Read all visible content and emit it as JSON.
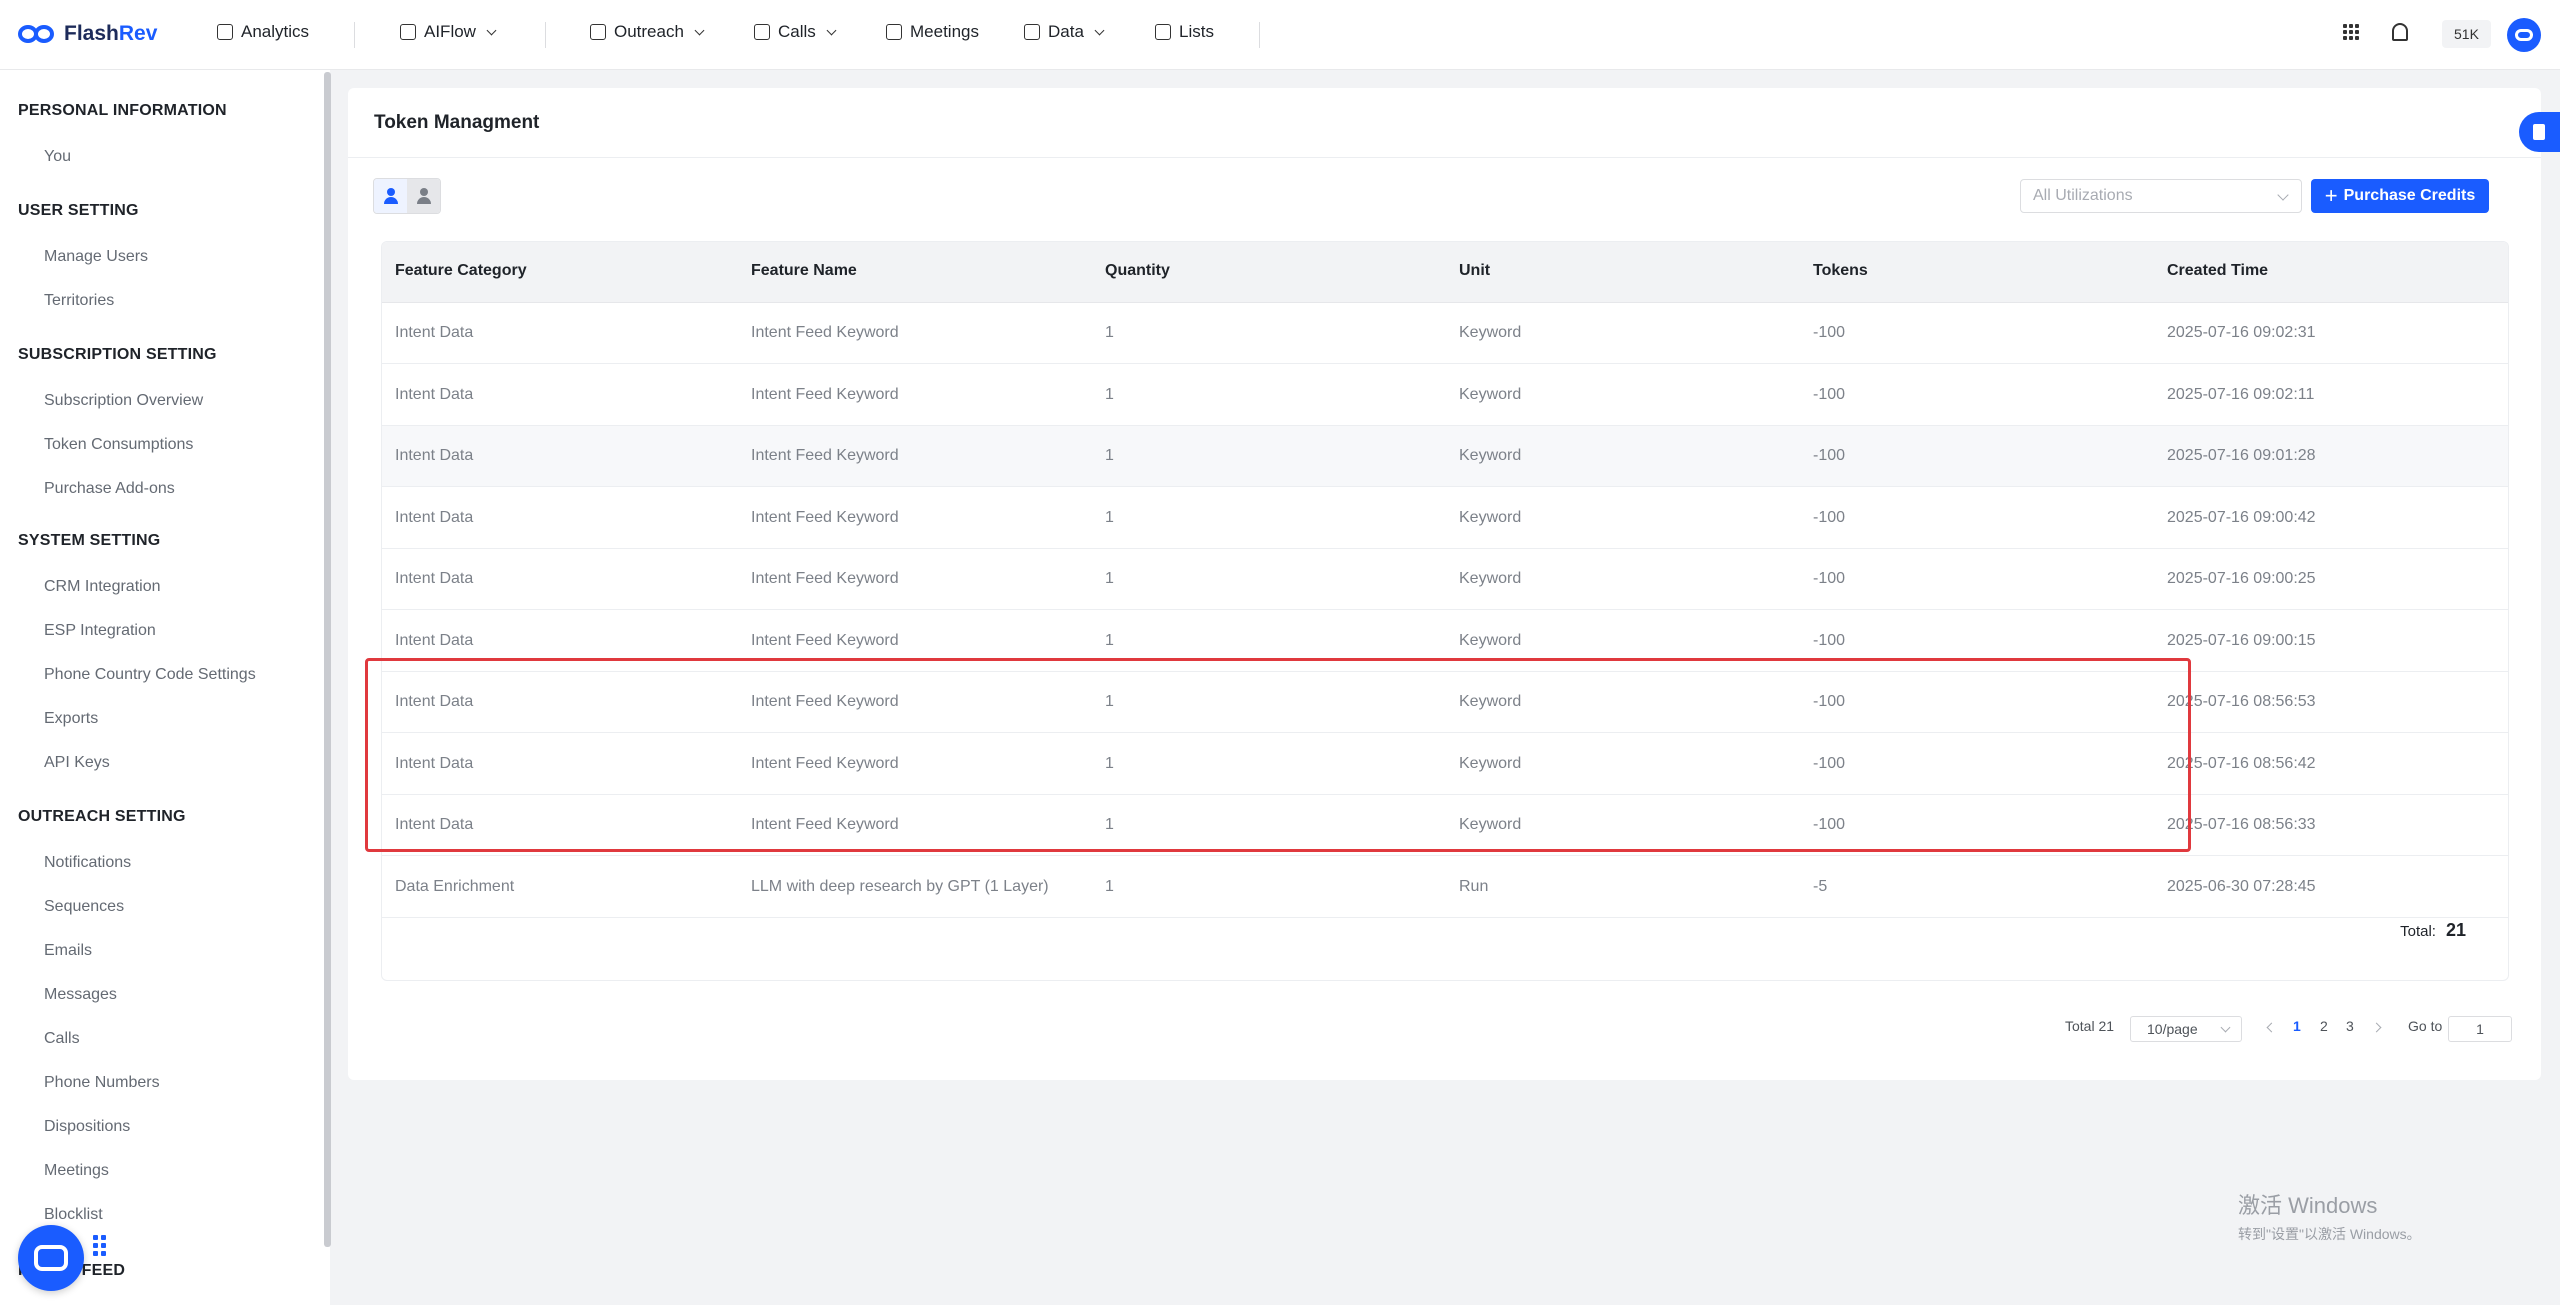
{
  "brand": {
    "name_part1": "Flash",
    "name_part2": "Rev",
    "accent": "#1a5cff"
  },
  "nav": {
    "analytics": "Analytics",
    "aiflow": "AIFlow",
    "outreach": "Outreach",
    "calls": "Calls",
    "meetings": "Meetings",
    "data": "Data",
    "lists": "Lists",
    "credits": "51K"
  },
  "sidebar": {
    "sections": [
      {
        "title": "PERSONAL INFORMATION",
        "items": [
          "You"
        ]
      },
      {
        "title": "USER SETTING",
        "items": [
          "Manage Users",
          "Territories"
        ]
      },
      {
        "title": "SUBSCRIPTION SETTING",
        "items": [
          "Subscription Overview",
          "Token Consumptions",
          "Purchase Add-ons"
        ]
      },
      {
        "title": "SYSTEM SETTING",
        "items": [
          "CRM Integration",
          "ESP Integration",
          "Phone Country Code Settings",
          "Exports",
          "API Keys"
        ]
      },
      {
        "title": "OUTREACH SETTING",
        "items": [
          "Notifications",
          "Sequences",
          "Emails",
          "Messages",
          "Calls",
          "Phone Numbers",
          "Dispositions",
          "Meetings",
          "Blocklist"
        ]
      },
      {
        "title": "INTENT FEED",
        "items": []
      }
    ]
  },
  "page": {
    "title": "Token Managment",
    "filter_placeholder": "All Utilizations",
    "purchase_label": "Purchase Credits"
  },
  "table": {
    "columns": [
      "Feature Category",
      "Feature Name",
      "Quantity",
      "Unit",
      "Tokens",
      "Created Time"
    ],
    "rows": [
      [
        "Intent Data",
        "Intent Feed Keyword",
        "1",
        "Keyword",
        "-100",
        "2025-07-16 09:02:31"
      ],
      [
        "Intent Data",
        "Intent Feed Keyword",
        "1",
        "Keyword",
        "-100",
        "2025-07-16 09:02:11"
      ],
      [
        "Intent Data",
        "Intent Feed Keyword",
        "1",
        "Keyword",
        "-100",
        "2025-07-16 09:01:28"
      ],
      [
        "Intent Data",
        "Intent Feed Keyword",
        "1",
        "Keyword",
        "-100",
        "2025-07-16 09:00:42"
      ],
      [
        "Intent Data",
        "Intent Feed Keyword",
        "1",
        "Keyword",
        "-100",
        "2025-07-16 09:00:25"
      ],
      [
        "Intent Data",
        "Intent Feed Keyword",
        "1",
        "Keyword",
        "-100",
        "2025-07-16 09:00:15"
      ],
      [
        "Intent Data",
        "Intent Feed Keyword",
        "1",
        "Keyword",
        "-100",
        "2025-07-16 08:56:53"
      ],
      [
        "Intent Data",
        "Intent Feed Keyword",
        "1",
        "Keyword",
        "-100",
        "2025-07-16 08:56:42"
      ],
      [
        "Intent Data",
        "Intent Feed Keyword",
        "1",
        "Keyword",
        "-100",
        "2025-07-16 08:56:33"
      ],
      [
        "Data Enrichment",
        "LLM with deep research by GPT (1 Layer)",
        "1",
        "Run",
        "-5",
        "2025-06-30 07:28:45"
      ]
    ],
    "total_label": "Total:",
    "total_value": "21"
  },
  "pagination": {
    "total_text": "Total 21",
    "page_size": "10/page",
    "pages": [
      "1",
      "2",
      "3"
    ],
    "current": "1",
    "goto_label": "Go to",
    "goto_value": "1"
  },
  "watermark": {
    "line1": "激活 Windows",
    "line2": "转到\"设置\"以激活 Windows。"
  }
}
